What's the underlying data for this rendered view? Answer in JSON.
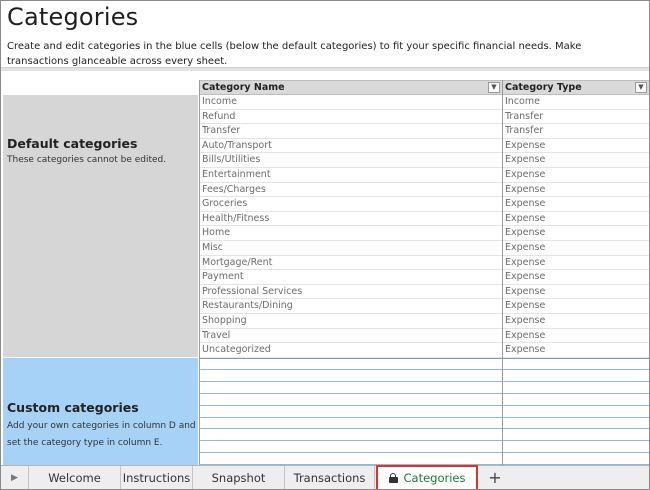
{
  "page": {
    "title": "Categories",
    "description": "Create and edit categories in the blue cells (below the default categories) to fit your specific financial needs. Make transactions glanceable across every sheet."
  },
  "default_section": {
    "title": "Default categories",
    "subtitle": "These categories cannot be edited."
  },
  "custom_section": {
    "title": "Custom categories",
    "subtitle": "Add your own categories in column D and set the category type in column E."
  },
  "table": {
    "columns": [
      "Category Name",
      "Category Type"
    ],
    "rows": [
      [
        "Income",
        "Income"
      ],
      [
        "Refund",
        "Transfer"
      ],
      [
        "Transfer",
        "Transfer"
      ],
      [
        "Auto/Transport",
        "Expense"
      ],
      [
        "Bills/Utilities",
        "Expense"
      ],
      [
        "Entertainment",
        "Expense"
      ],
      [
        "Fees/Charges",
        "Expense"
      ],
      [
        "Groceries",
        "Expense"
      ],
      [
        "Health/Fitness",
        "Expense"
      ],
      [
        "Home",
        "Expense"
      ],
      [
        "Misc",
        "Expense"
      ],
      [
        "Mortgage/Rent",
        "Expense"
      ],
      [
        "Payment",
        "Expense"
      ],
      [
        "Professional Services",
        "Expense"
      ],
      [
        "Restaurants/Dining",
        "Expense"
      ],
      [
        "Shopping",
        "Expense"
      ],
      [
        "Travel",
        "Expense"
      ],
      [
        "Uncategorized",
        "Expense"
      ]
    ],
    "dropdown_glyph": "▼"
  },
  "tabs": {
    "prev_glyph": "▶",
    "items": [
      "Welcome",
      "Instructions",
      "Snapshot",
      "Transactions",
      "Categories"
    ],
    "active": "Categories",
    "add_glyph": "+"
  },
  "colors": {
    "custom_fill": "#a6d2f7",
    "default_fill": "#d6d6d6",
    "active_tab_border": "#d9352c",
    "active_tab_text": "#1f7a34"
  }
}
